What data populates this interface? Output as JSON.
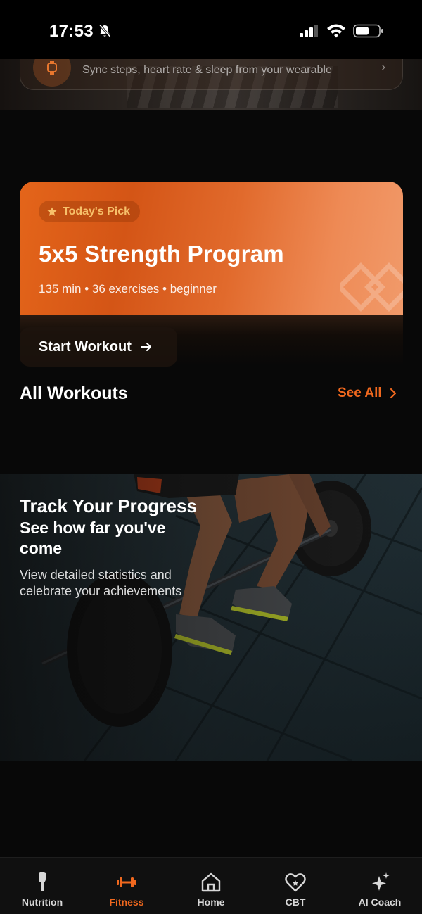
{
  "status_bar": {
    "time": "17:53"
  },
  "sync_card": {
    "text": "Sync steps, heart rate & sleep from your wearable",
    "chevron": "›"
  },
  "todays_pick": {
    "badge": "Today's Pick",
    "title": "5x5 Strength Program",
    "meta": "135 min • 36 exercises • beginner",
    "start_label": "Start Workout"
  },
  "workouts_section": {
    "title": "All Workouts",
    "see_all_label": "See All"
  },
  "progress_banner": {
    "title": "Track Your Progress",
    "subtitle": "See how far you've come",
    "description": "View detailed statistics and celebrate your achievements"
  },
  "tab_bar": {
    "items": [
      {
        "label": "Nutrition",
        "icon": "nutrition-icon",
        "active": false
      },
      {
        "label": "Fitness",
        "icon": "dumbbell-icon",
        "active": true
      },
      {
        "label": "Home",
        "icon": "home-icon",
        "active": false
      },
      {
        "label": "CBT",
        "icon": "heart-icon",
        "active": false
      },
      {
        "label": "AI Coach",
        "icon": "sparkles-icon",
        "active": false
      }
    ]
  },
  "colors": {
    "accent": "#f0681e",
    "background": "#080808",
    "badge_text": "#f7c06a"
  }
}
